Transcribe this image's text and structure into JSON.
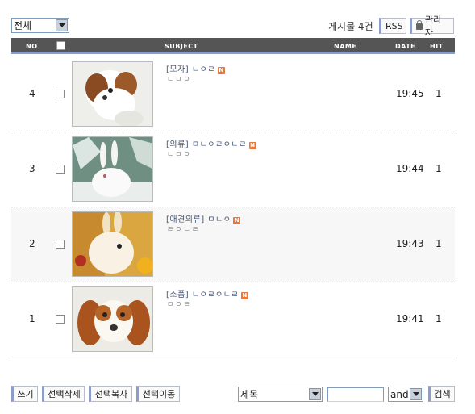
{
  "top_bar": {
    "category_selected": "전체",
    "post_count": "게시물 4건",
    "rss_label": "RSS",
    "admin_label": "관리자"
  },
  "header": {
    "no": "NO",
    "subject": "SUBJECT",
    "name": "NAME",
    "date": "DATE",
    "hit": "HIT"
  },
  "rows": [
    {
      "no": "4",
      "category": "[모자]",
      "title": "ㄴㅇㄹ",
      "new_badge": "N",
      "preview": "ㄴㅁㅇ",
      "date": "19:45",
      "hit": "1",
      "thumb": "puppy-shihtzu"
    },
    {
      "no": "3",
      "category": "[의류]",
      "title": "ㅁㄴㅇㄹㅇㄴㄹ",
      "new_badge": "N",
      "preview": "ㄴㅁㅇ",
      "date": "19:44",
      "hit": "1",
      "thumb": "white-rabbit-snow"
    },
    {
      "no": "2",
      "category": "[애견의류]",
      "title": "ㅁㄴㅇ",
      "new_badge": "N",
      "preview": "ㄹㅇㄴㄹ",
      "date": "19:43",
      "hit": "1",
      "thumb": "bunny-fruit"
    },
    {
      "no": "1",
      "category": "[소품]",
      "title": "ㄴㅇㄹㅇㄴㄹ",
      "new_badge": "N",
      "preview": "ㅁㅇㄹ",
      "date": "19:41",
      "hit": "1",
      "thumb": "cavalier-puppy"
    }
  ],
  "bottom": {
    "write_label": "쓰기",
    "delete_selected_label": "선택삭제",
    "copy_selected_label": "선택복사",
    "move_selected_label": "선택이동",
    "search_field_selected": "제목",
    "search_value": "",
    "search_operator": "and",
    "search_label": "검색"
  },
  "colors": {
    "header_bg": "#555555",
    "header_accent": "#8e9cc8",
    "new_badge": "#e8783c",
    "subject_text": "#445577"
  }
}
